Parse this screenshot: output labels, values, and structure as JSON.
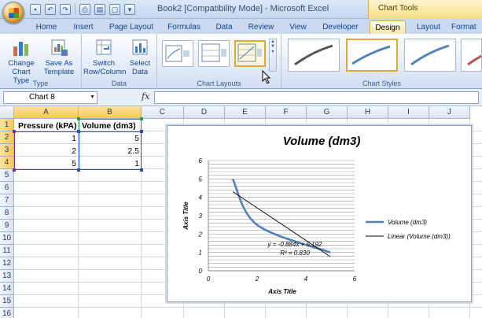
{
  "window": {
    "title": "Book2  [Compatibility Mode]  -  Microsoft Excel",
    "context_tab": "Chart Tools"
  },
  "ribbon_tabs": [
    "Home",
    "Insert",
    "Page Layout",
    "Formulas",
    "Data",
    "Review",
    "View",
    "Developer",
    "Design",
    "Layout",
    "Format"
  ],
  "active_tab": "Design",
  "ribbon": {
    "groups": {
      "type": {
        "label": "Type",
        "change_chart_type": "Change Chart Type",
        "save_as_template": "Save As Template"
      },
      "data": {
        "label": "Data",
        "switch_row_column": "Switch Row/Column",
        "select_data": "Select Data"
      },
      "chart_layouts": {
        "label": "Chart Layouts"
      },
      "chart_styles": {
        "label": "Chart Styles"
      }
    }
  },
  "formula_bar": {
    "name_box": "Chart 8",
    "fx": "fx",
    "formula": ""
  },
  "sheet": {
    "columns": [
      "A",
      "B",
      "C",
      "D",
      "E",
      "F",
      "G",
      "H",
      "I",
      "J"
    ],
    "rows": [
      "1",
      "2",
      "3",
      "4",
      "5",
      "6",
      "7",
      "8",
      "9",
      "10",
      "11",
      "12",
      "13",
      "14",
      "15",
      "16"
    ],
    "cells": {
      "A1": "Pressure (kPA)",
      "B1": "Volume (dm3)",
      "A2": "1",
      "B2": "5",
      "A3": "2",
      "B3": "2.5",
      "A4": "5",
      "B4": "1"
    }
  },
  "chart_data": {
    "type": "scatter",
    "title": "Volume (dm3)",
    "xlabel": "Axis Title",
    "ylabel": "Axis Title",
    "xlim": [
      0,
      6
    ],
    "ylim": [
      0,
      6
    ],
    "x_ticks": [
      "0",
      "2",
      "4",
      "6"
    ],
    "y_ticks": [
      "0",
      "1",
      "2",
      "3",
      "4",
      "5",
      "6"
    ],
    "series": [
      {
        "name": "Volume (dm3)",
        "x": [
          1,
          2,
          5
        ],
        "y": [
          5,
          2.5,
          1
        ],
        "style": "smooth-line",
        "color": "#4f81bd"
      },
      {
        "name": "Linear (Volume (dm3))",
        "x": [
          1,
          5
        ],
        "y": [
          4.308,
          0.772
        ],
        "style": "trendline",
        "color": "#000000"
      }
    ],
    "annotations": [
      "y = -0.884x + 5.192",
      "R² = 0.830"
    ],
    "legend_position": "right",
    "grid": "horizontal-minor"
  },
  "colors": {
    "accent": "#4f81bd",
    "tab_active": "#f7e7a9",
    "ribbon": "#d0def1"
  }
}
